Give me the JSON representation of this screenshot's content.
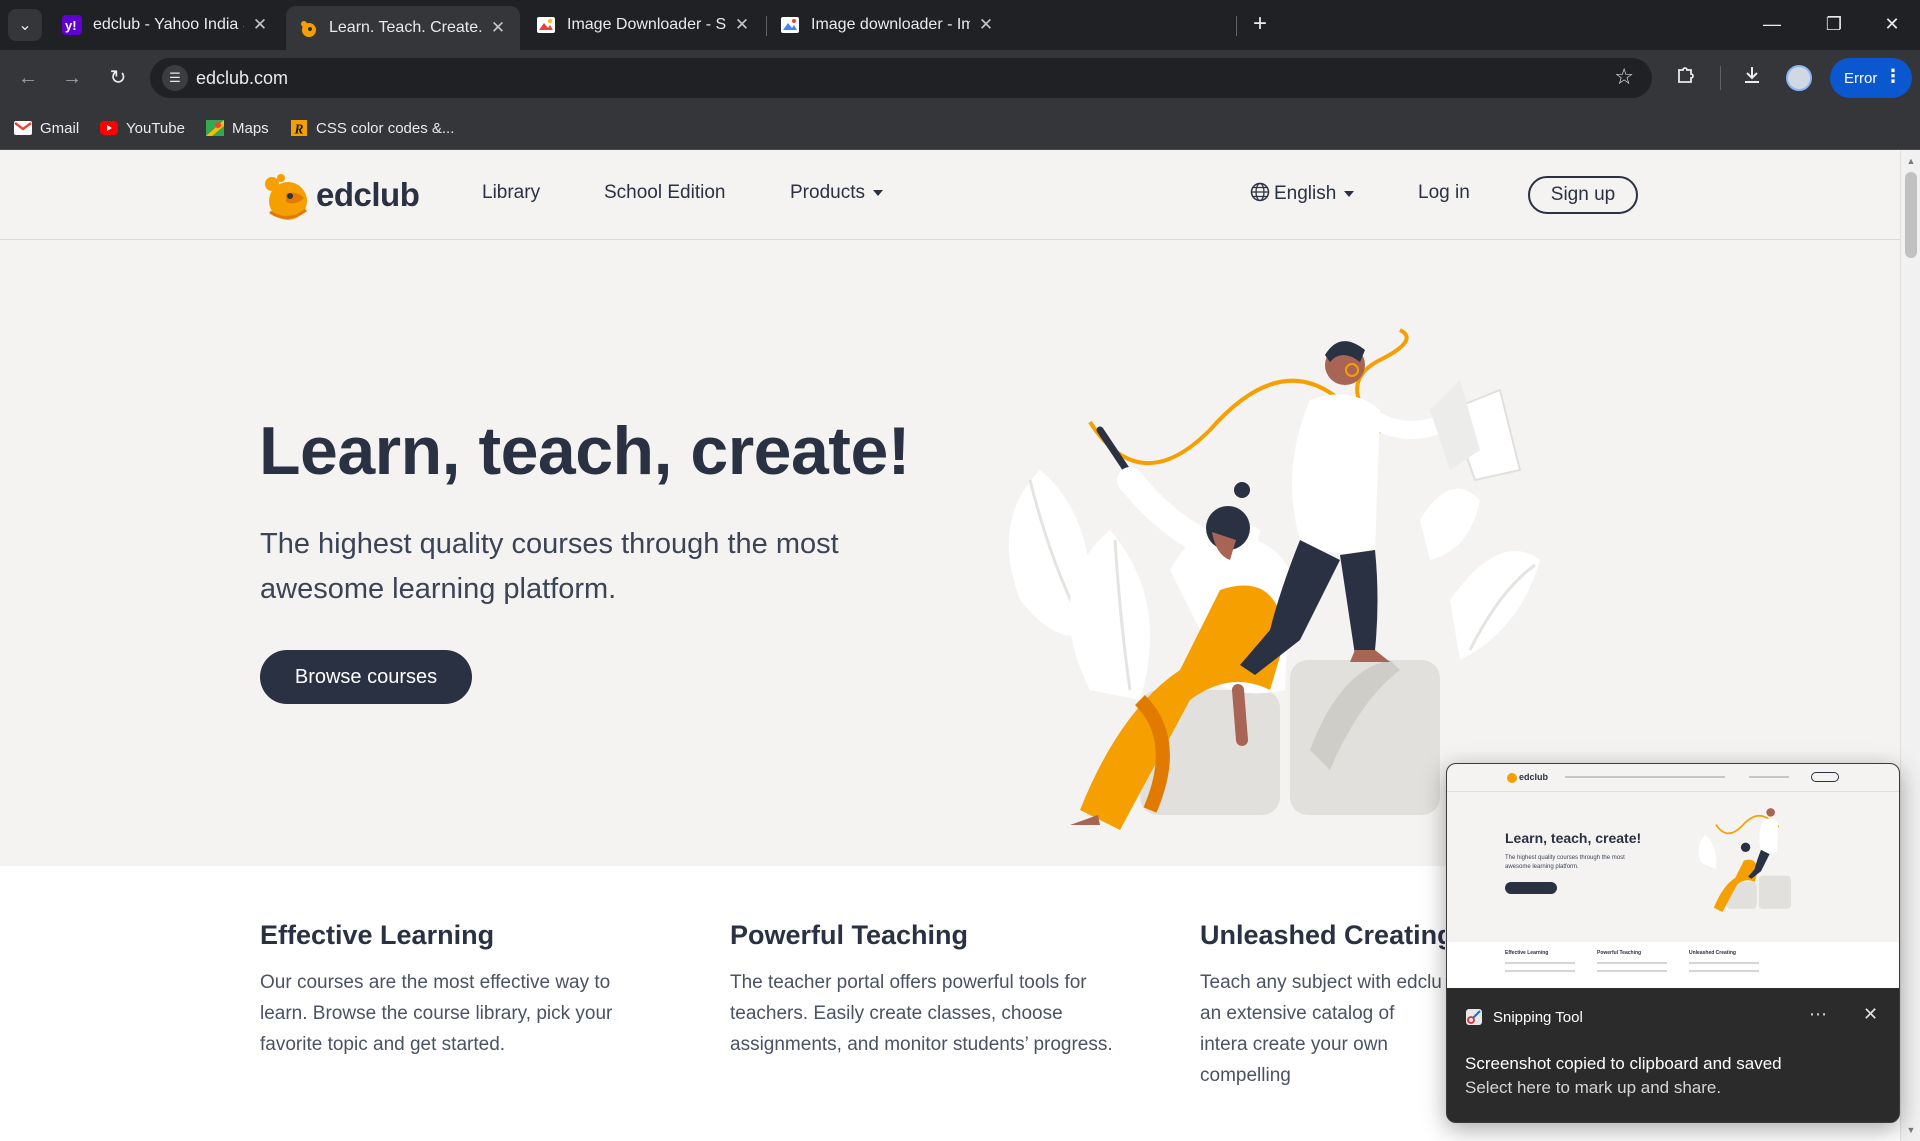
{
  "browser": {
    "tabs": [
      {
        "title": "edclub - Yahoo India Search Re",
        "favicon": "yahoo-icon"
      },
      {
        "title": "Learn. Teach. Create. | edclub",
        "favicon": "edclub-icon",
        "active": true
      },
      {
        "title": "Image Downloader - Save pictu",
        "favicon": "image-downloader-icon"
      },
      {
        "title": "Image downloader - Imageye",
        "favicon": "imageye-icon"
      }
    ],
    "url": "edclub.com",
    "error_label": "Error",
    "bookmarks": [
      "Gmail",
      "YouTube",
      "Maps",
      "CSS color codes &..."
    ]
  },
  "site": {
    "logo_text": "edclub",
    "nav": {
      "library": "Library",
      "school_edition": "School Edition",
      "products": "Products",
      "language": "English",
      "login": "Log in",
      "signup": "Sign up"
    },
    "hero": {
      "title": "Learn, teach, create!",
      "subtitle": "The highest quality courses through the most awesome learning platform.",
      "cta": "Browse courses"
    },
    "features": [
      {
        "title": "Effective Learning",
        "text": "Our courses are the most effective way to learn. Browse the course library, pick your favorite topic and get started."
      },
      {
        "title": "Powerful Teaching",
        "text": "The teacher portal offers powerful tools for teachers. Easily create classes, choose assignments, and monitor students’ progress."
      },
      {
        "title": "Unleashed Creating",
        "text": "Teach any subject with edclu an extensive catalog of intera create your own compelling"
      }
    ]
  },
  "toast": {
    "app": "Snipping Tool",
    "message": "Screenshot copied to clipboard and saved",
    "sub": "Select here to mark up and share.",
    "thumb": {
      "logo_text": "edclub",
      "title": "Learn, teach, create!",
      "subtitle": "The highest quality courses through the most awesome learning platform.",
      "features": [
        "Effective Learning",
        "Powerful Teaching",
        "Unleashed Creating"
      ]
    }
  },
  "colors": {
    "brand_dark": "#2a3142",
    "brand_orange": "#f5a000",
    "page_bg": "#f4f3f1"
  }
}
